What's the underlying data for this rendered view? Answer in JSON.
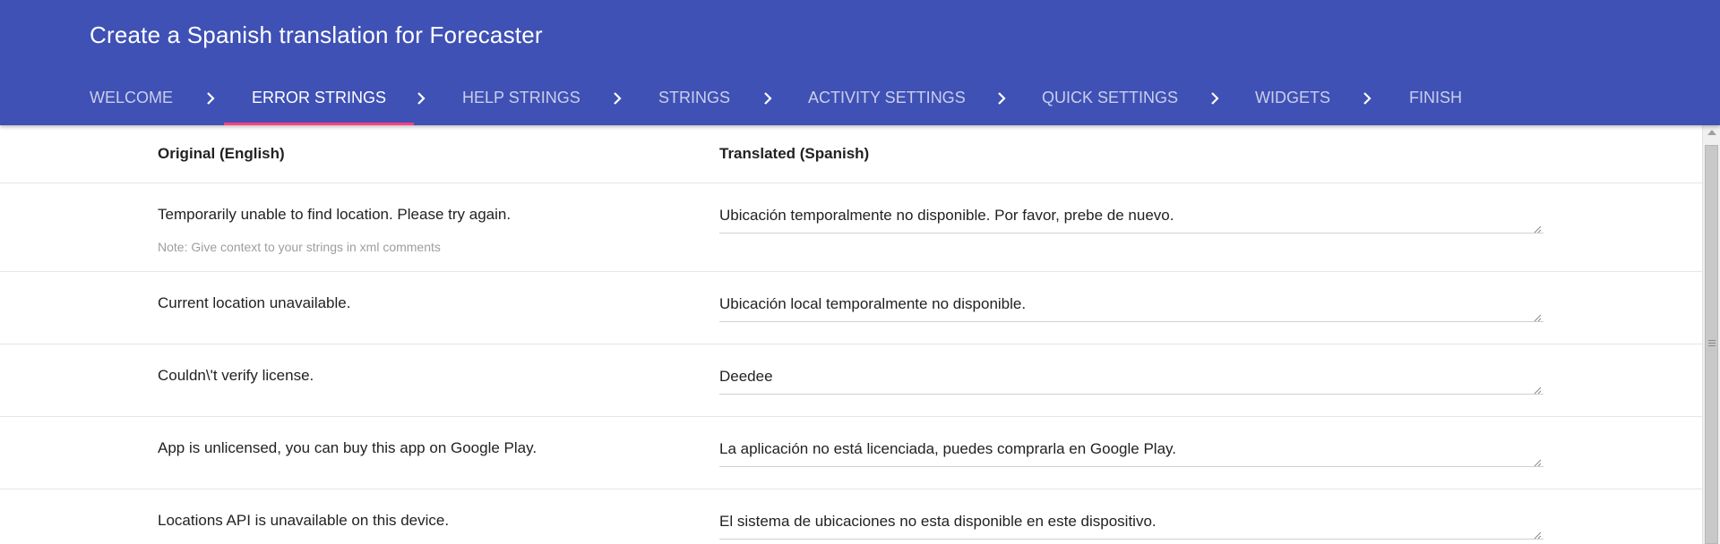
{
  "header": {
    "title": "Create a Spanish translation for Forecaster",
    "background_color": "#3f51b5",
    "active_tab_indicator_color": "#ff4081"
  },
  "tabs": [
    {
      "label": "WELCOME",
      "active": false
    },
    {
      "label": "ERROR STRINGS",
      "active": true
    },
    {
      "label": "HELP STRINGS",
      "active": false
    },
    {
      "label": "STRINGS",
      "active": false
    },
    {
      "label": "ACTIVITY SETTINGS",
      "active": false
    },
    {
      "label": "QUICK SETTINGS",
      "active": false
    },
    {
      "label": "WIDGETS",
      "active": false
    },
    {
      "label": "FINISH",
      "active": false
    }
  ],
  "table": {
    "columns": [
      "Original (English)",
      "Translated (Spanish)"
    ],
    "rows": [
      {
        "original": "Temporarily unable to find location. Please try again.",
        "note": "Note: Give context to your strings in xml comments",
        "translated": "Ubicación temporalmente no disponible. Por favor, prebe de nuevo."
      },
      {
        "original": "Current location unavailable.",
        "translated": "Ubicación local temporalmente no disponible."
      },
      {
        "original": "Couldn\\'t verify license.",
        "translated": "Deedee"
      },
      {
        "original": "App is unlicensed, you can buy this app on Google Play.",
        "translated": "La aplicación no está licenciada, puedes comprarla en Google Play."
      },
      {
        "original": "Locations API is unavailable on this device.",
        "translated": "El sistema de ubicaciones no esta disponible en este dispositivo."
      }
    ]
  },
  "icons": {
    "tab_separator": "chevron-right-icon",
    "textarea_resize": "resize-grip-icon",
    "scroll_up": "scroll-up-arrow-icon"
  }
}
